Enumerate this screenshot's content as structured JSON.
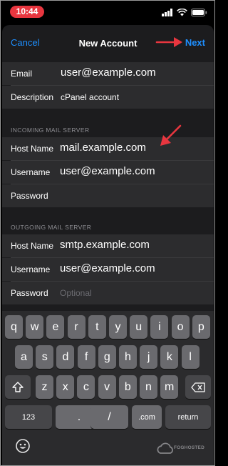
{
  "status_bar": {
    "time": "10:44",
    "icons": [
      "signal-icon",
      "wifi-icon",
      "battery-icon"
    ]
  },
  "nav": {
    "cancel_label": "Cancel",
    "title": "New Account",
    "next_label": "Next"
  },
  "account": {
    "email_label": "Email",
    "email_value": "user@example.com",
    "description_label": "Description",
    "description_value": "cPanel account"
  },
  "incoming": {
    "header": "INCOMING MAIL SERVER",
    "host_label": "Host Name",
    "host_value": "mail.example.com",
    "user_label": "Username",
    "user_value": "user@example.com",
    "password_label": "Password",
    "password_value": ""
  },
  "outgoing": {
    "header": "OUTGOING MAIL SERVER",
    "host_label": "Host Name",
    "host_value": "smtp.example.com",
    "user_label": "Username",
    "user_value": "user@example.com",
    "password_label": "Password",
    "password_placeholder": "Optional"
  },
  "keyboard": {
    "row1": [
      "q",
      "w",
      "e",
      "r",
      "t",
      "y",
      "u",
      "i",
      "o",
      "p"
    ],
    "row2": [
      "a",
      "s",
      "d",
      "f",
      "g",
      "h",
      "j",
      "k",
      "l"
    ],
    "row3": [
      "z",
      "x",
      "c",
      "v",
      "b",
      "n",
      "m"
    ],
    "numbers_label": "123",
    "dot_label": ".",
    "slash_label": "/",
    "com_label": ".com",
    "return_label": "return"
  },
  "watermark": {
    "text": "FOGHOSTED"
  },
  "colors": {
    "accent": "#1e8fff",
    "arrow": "#e8363f",
    "time_pill": "#e8363f"
  }
}
